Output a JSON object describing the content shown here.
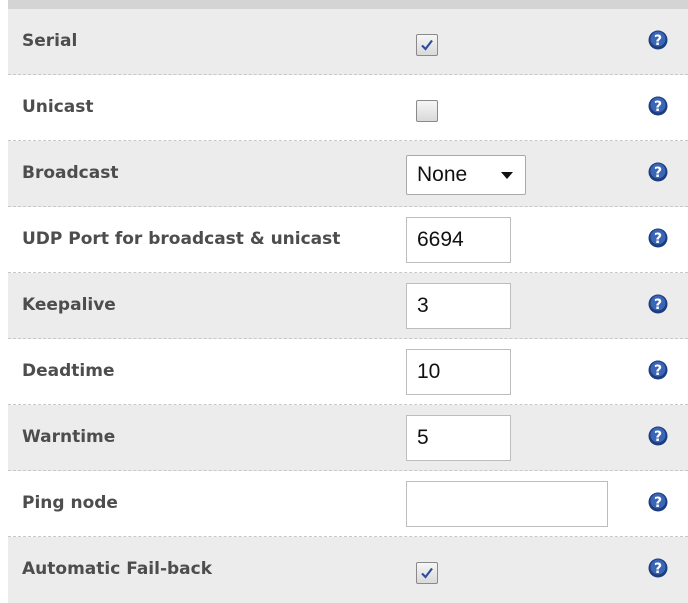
{
  "colors": {
    "row_shade": "#ececec",
    "label_text": "#4d4d4d",
    "help_icon": "#1c3d80"
  },
  "form": {
    "rows": [
      {
        "id": "serial",
        "label": "Serial",
        "control": "checkbox",
        "checked": true
      },
      {
        "id": "unicast",
        "label": "Unicast",
        "control": "checkbox",
        "checked": false
      },
      {
        "id": "broadcast",
        "label": "Broadcast",
        "control": "select",
        "value": "None"
      },
      {
        "id": "udp-port",
        "label": "UDP Port for broadcast & unicast",
        "control": "text",
        "value": "6694"
      },
      {
        "id": "keepalive",
        "label": "Keepalive",
        "control": "text",
        "value": "3"
      },
      {
        "id": "deadtime",
        "label": "Deadtime",
        "control": "text",
        "value": "10"
      },
      {
        "id": "warntime",
        "label": "Warntime",
        "control": "text",
        "value": "5"
      },
      {
        "id": "ping-node",
        "label": "Ping node",
        "control": "text",
        "value": ""
      },
      {
        "id": "auto-failback",
        "label": "Automatic Fail-back",
        "control": "checkbox",
        "checked": true
      }
    ],
    "help_icon": "question-circle-icon"
  }
}
